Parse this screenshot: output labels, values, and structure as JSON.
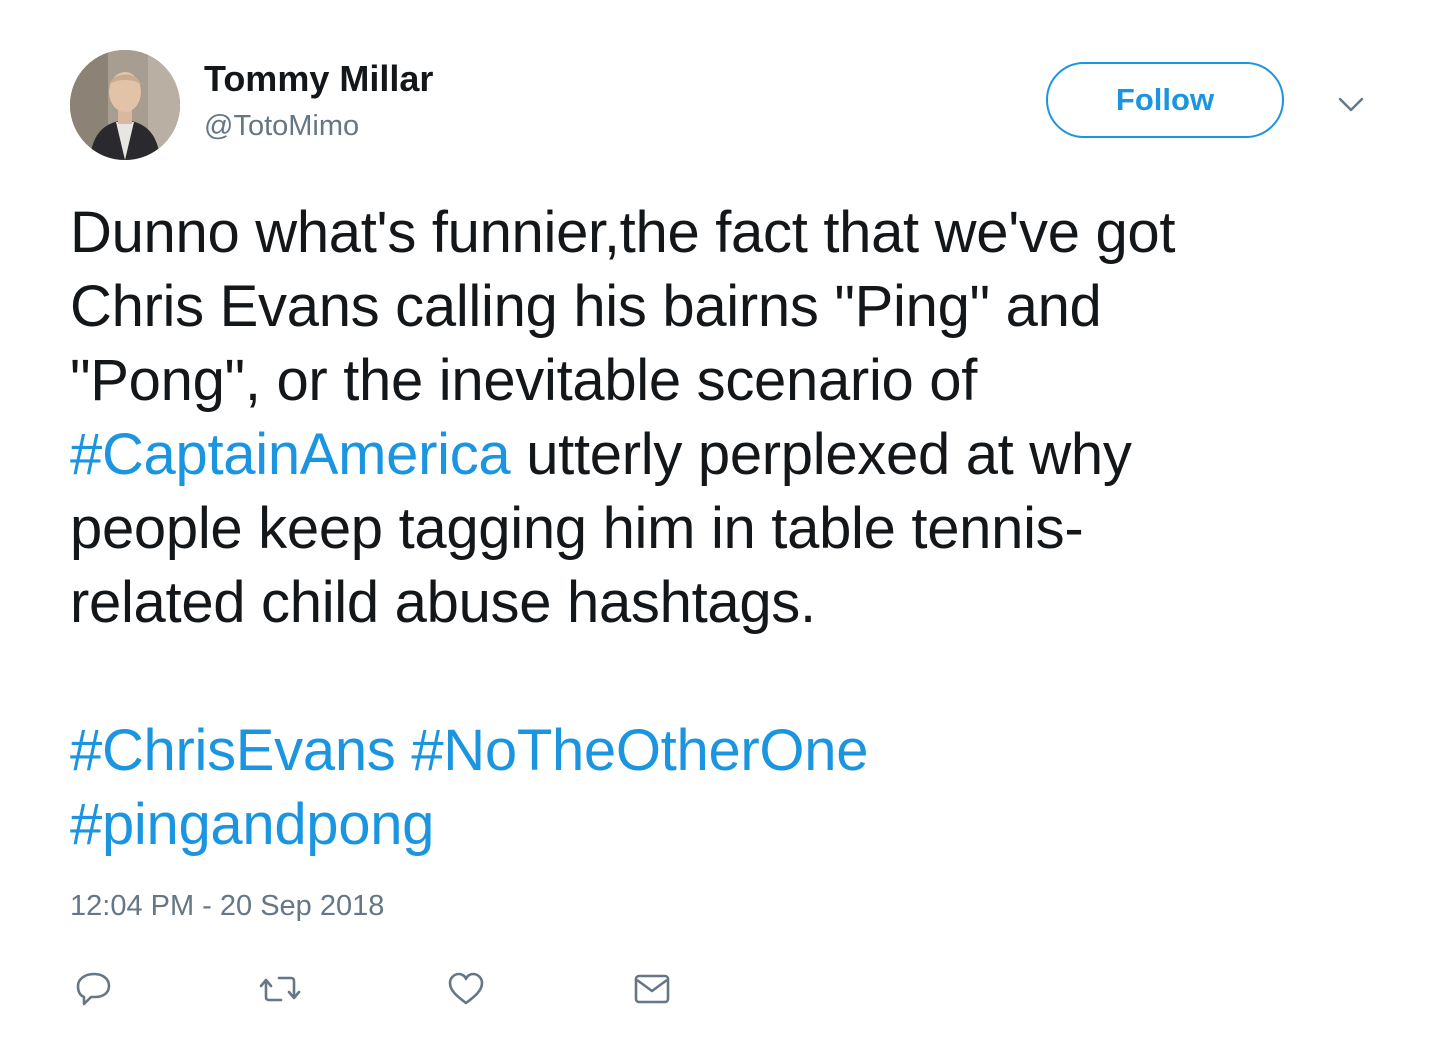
{
  "user": {
    "display_name": "Tommy Millar",
    "screen_name": "@TotoMimo",
    "avatar_icon": "user-avatar-photo"
  },
  "follow": {
    "label": "Follow",
    "caret_icon": "chevron-down-icon"
  },
  "tweet": {
    "line1": "Dunno what's funnier,the fact that we've got",
    "line2": "Chris Evans calling his bairns \"Ping\" and",
    "line3": "\"Pong\", or the inevitable scenario of",
    "hashtag_captain": "#CaptainAmerica",
    "line4_rest": " utterly perplexed at why",
    "line5": "people keep tagging him in table tennis-",
    "line6": "related child abuse hashtags.",
    "hashtag_chris": "#ChrisEvans",
    "hashtag_notheotherone": "#NoTheOtherOne",
    "hashtag_pingandpong": "#pingandpong"
  },
  "timestamp": "12:04 PM - 20 Sep 2018",
  "actions": [
    {
      "name": "reply",
      "icon": "reply-icon"
    },
    {
      "name": "retweet",
      "icon": "retweet-icon"
    },
    {
      "name": "like",
      "icon": "heart-icon"
    },
    {
      "name": "message",
      "icon": "envelope-icon"
    }
  ],
  "colors": {
    "link": "#1b95e0",
    "text": "#14171a",
    "secondary": "#657786"
  }
}
